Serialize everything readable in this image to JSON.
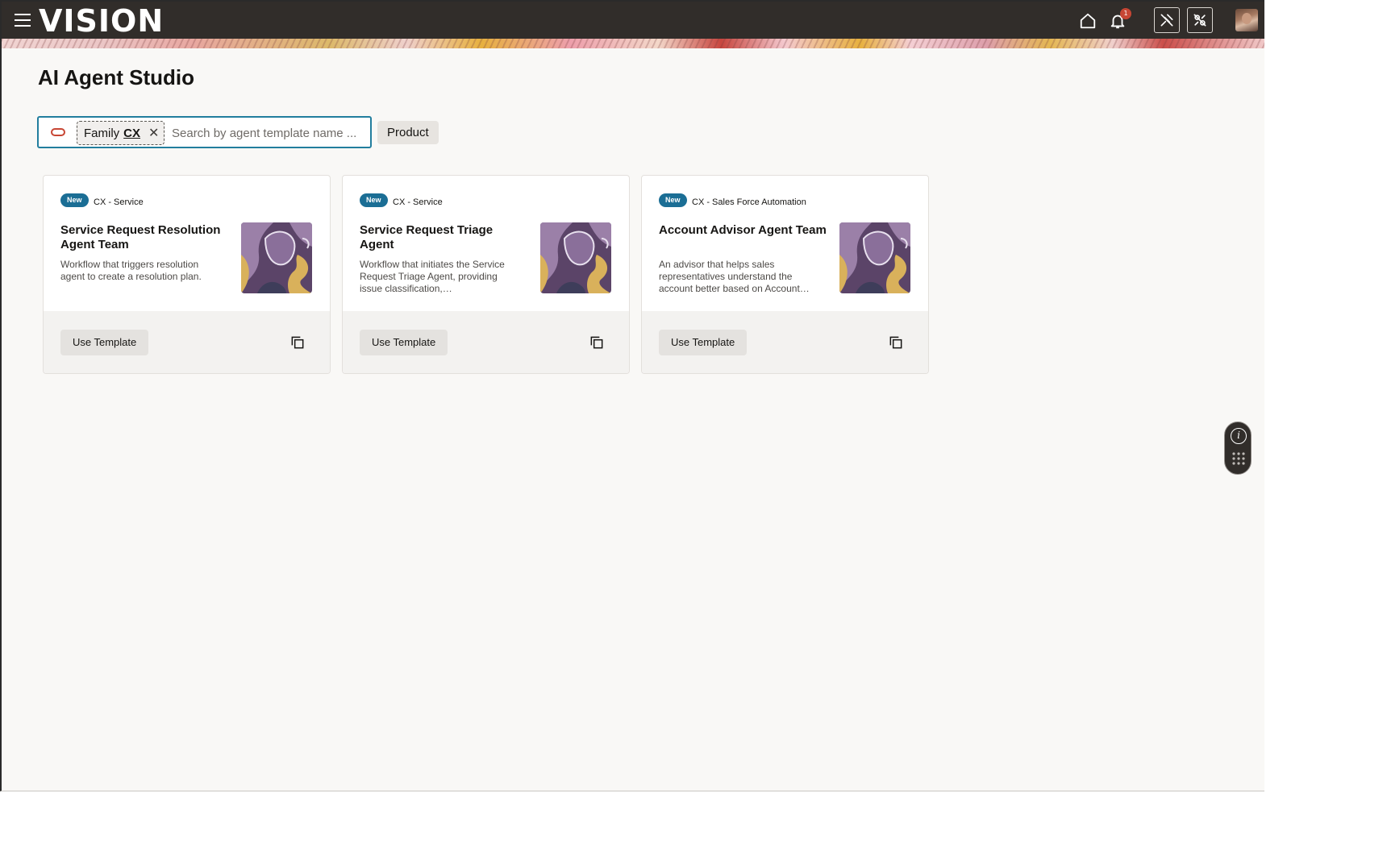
{
  "header": {
    "logo_text": "VISION",
    "notification_count": "1"
  },
  "page": {
    "title": "AI Agent Studio"
  },
  "search": {
    "chip_label": "Family",
    "chip_value": "CX",
    "placeholder": "Search by agent template name ...",
    "product_filter_label": "Product"
  },
  "cards": [
    {
      "badge": "New",
      "category": "CX - Service",
      "title": "Service Request Resolution Agent Team",
      "description": "Workflow that triggers resolution agent to create a resolution plan.",
      "button_label": "Use Template"
    },
    {
      "badge": "New",
      "category": "CX - Service",
      "title": "Service Request Triage Agent",
      "description": "Workflow that initiates the Service Request Triage Agent, providing issue classification, troubleshooting…",
      "button_label": "Use Template"
    },
    {
      "badge": "New",
      "category": "CX - Sales Force Automation",
      "title": "Account Advisor Agent Team",
      "description": "An advisor that helps sales representatives understand the account better based on Account…",
      "button_label": "Use Template"
    }
  ],
  "colors": {
    "header_bg": "#312d2a",
    "badge_bg": "#1b6e95",
    "focus_border": "#227e9e",
    "notification": "#c74634",
    "art_purple": "#5b4468",
    "art_lilac": "#9b80a8",
    "art_gold": "#d9b15b"
  },
  "icons": {
    "menu": "hamburger-icon",
    "home": "home-icon",
    "notifications": "bell-icon",
    "tool1": "pin-off-icon",
    "tool2": "link-off-icon",
    "copy": "copy-icon",
    "info": "info-icon",
    "grid": "dots-grid-icon"
  }
}
